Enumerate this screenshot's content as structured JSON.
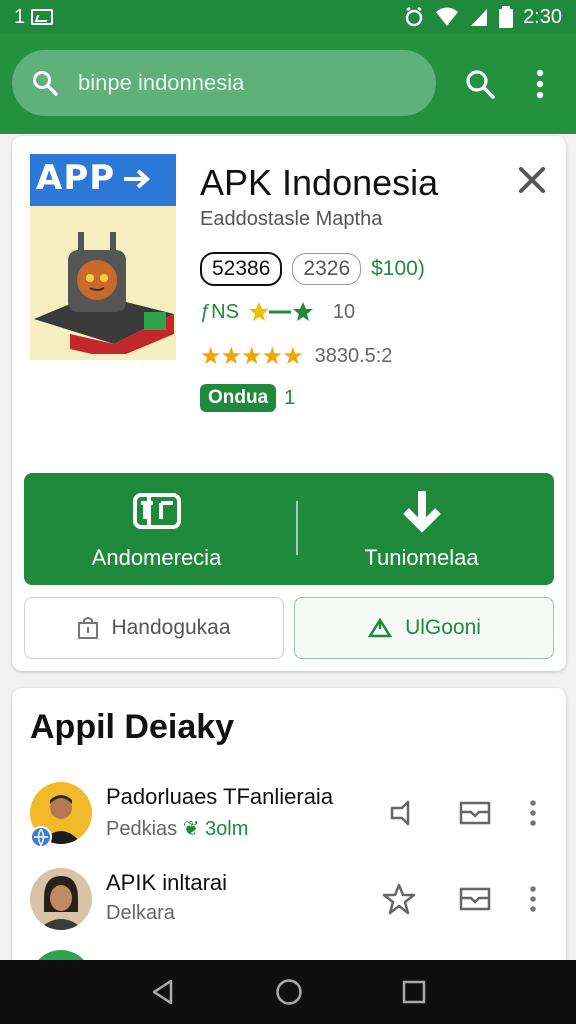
{
  "status_bar": {
    "left_text": "1",
    "time": "2:30"
  },
  "search": {
    "placeholder": "binpe indonnesia"
  },
  "app": {
    "icon_banner": "APP",
    "title": "APK Indonesia",
    "subtitle": "Eaddostasle Maptha",
    "chip_primary": "52386",
    "chip_secondary": "2326",
    "price": "$100)",
    "tags": "ƒNS",
    "tags_count": "10",
    "rating_value": "3830.5:2",
    "badge": "Ondua",
    "badge_count": "1"
  },
  "actions": {
    "primary_left": "Andomerecia",
    "primary_right": "Tuniomelaa",
    "secondary_left": "Handogukaa",
    "secondary_right": "UlGooni"
  },
  "section": {
    "title": "Appil Deiaky",
    "items": [
      {
        "name": "Padorluaes TFanlieraia",
        "sub_gray": "Pedkias",
        "sub_green": "3olm"
      },
      {
        "name": "APIK inltarai",
        "sub_gray": "Delkara",
        "sub_green": ""
      }
    ]
  },
  "colors": {
    "brand_green": "#1f8a3c",
    "appbar_green": "#23913f",
    "star_gold": "#f0a500"
  }
}
